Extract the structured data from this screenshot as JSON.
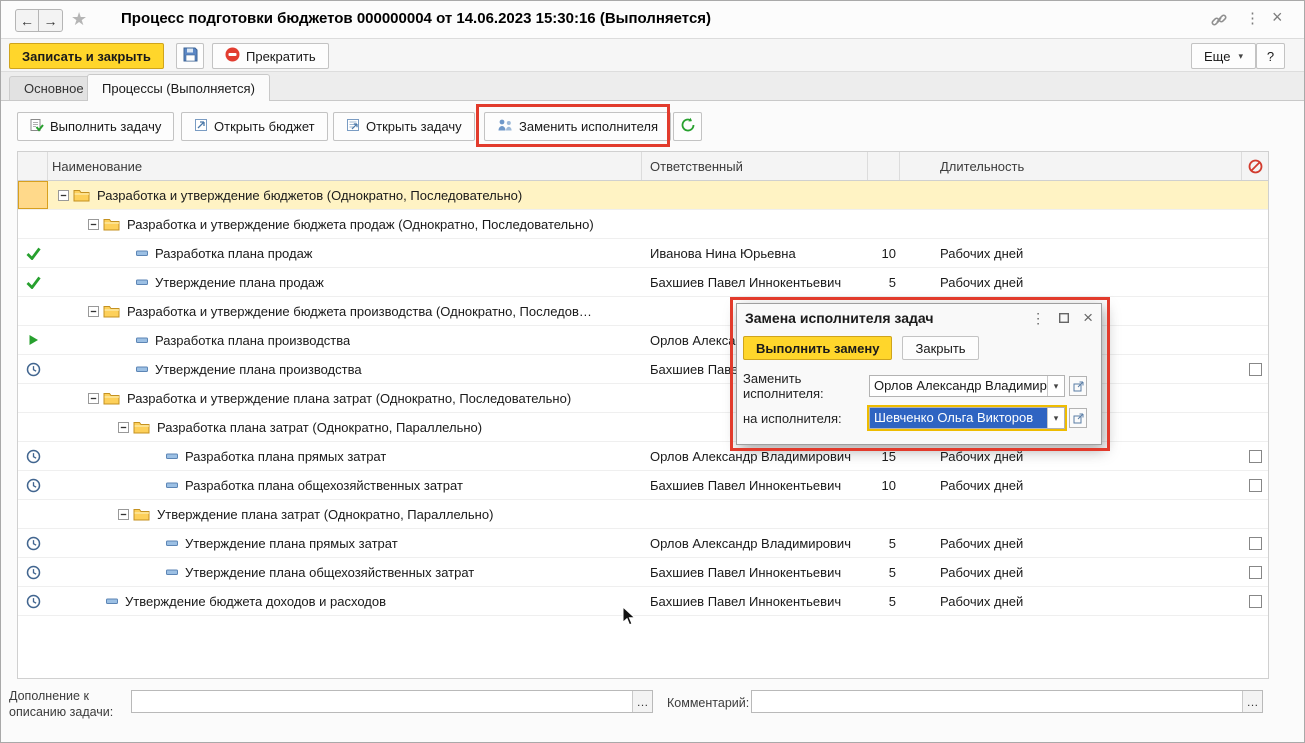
{
  "window": {
    "title": "Процесс подготовки бюджетов 000000004 от 14.06.2023 15:30:16 (Выполняется)"
  },
  "toolbar": {
    "save_and_close": "Записать и закрыть",
    "stop": "Прекратить",
    "more": "Еще",
    "help": "?"
  },
  "tabs": [
    {
      "label": "Основное"
    },
    {
      "label": "Процессы (Выполняется)"
    }
  ],
  "commandbar": {
    "execute_task": "Выполнить задачу",
    "open_budget": "Открыть бюджет",
    "open_task": "Открыть задачу",
    "replace_executor": "Заменить исполнителя"
  },
  "table": {
    "headers": {
      "name": "Наименование",
      "responsible": "Ответственный",
      "duration": "Длительность"
    },
    "rows": [
      {
        "kind": "group",
        "level": 1,
        "status": null,
        "name": "Разработка и утверждение бюджетов (Однократно, Последовательно)",
        "responsible": "",
        "duration": "",
        "units": "",
        "checkbox": false,
        "selected": true
      },
      {
        "kind": "group",
        "level": 2,
        "status": null,
        "name": "Разработка и утверждение бюджета продаж (Однократно, Последовательно)",
        "responsible": "",
        "duration": "",
        "units": "",
        "checkbox": false,
        "selected": false
      },
      {
        "kind": "task",
        "level": 3,
        "status": "done",
        "name": "Разработка плана продаж",
        "responsible": "Иванова Нина Юрьевна",
        "duration": "10",
        "units": "Рабочих дней",
        "checkbox": false,
        "selected": false
      },
      {
        "kind": "task",
        "level": 3,
        "status": "done",
        "name": "Утверждение плана продаж",
        "responsible": "Бахшиев Павел Иннокентьевич",
        "duration": "5",
        "units": "Рабочих дней",
        "checkbox": false,
        "selected": false
      },
      {
        "kind": "group",
        "level": 2,
        "status": null,
        "name": "Разработка и утверждение бюджета производства (Однократно, Последов…",
        "responsible": "",
        "duration": "",
        "units": "",
        "checkbox": false,
        "selected": false
      },
      {
        "kind": "task",
        "level": 3,
        "status": "running",
        "name": "Разработка плана производства",
        "responsible": "Орлов Александр Владимирович",
        "duration": "",
        "units": "",
        "checkbox": false,
        "selected": false
      },
      {
        "kind": "task",
        "level": 3,
        "status": "pending",
        "name": "Утверждение плана производства",
        "responsible": "Бахшиев Павел Иннокентьевич",
        "duration": "",
        "units": "",
        "checkbox": true,
        "selected": false
      },
      {
        "kind": "group",
        "level": 2,
        "status": null,
        "name": "Разработка и утверждение плана затрат (Однократно, Последовательно)",
        "responsible": "",
        "duration": "",
        "units": "",
        "checkbox": false,
        "selected": false
      },
      {
        "kind": "group",
        "level": 3,
        "status": null,
        "name": "Разработка плана затрат (Однократно, Параллельно)",
        "responsible": "",
        "duration": "",
        "units": "",
        "checkbox": false,
        "selected": false
      },
      {
        "kind": "task",
        "level": 4,
        "status": "pending",
        "name": "Разработка плана прямых затрат",
        "responsible": "Орлов Александр Владимирович",
        "duration": "15",
        "units": "Рабочих дней",
        "checkbox": true,
        "selected": false
      },
      {
        "kind": "task",
        "level": 4,
        "status": "pending",
        "name": "Разработка плана общехозяйственных затрат",
        "responsible": "Бахшиев Павел Иннокентьевич",
        "duration": "10",
        "units": "Рабочих дней",
        "checkbox": true,
        "selected": false
      },
      {
        "kind": "group",
        "level": 3,
        "status": null,
        "name": "Утверждение плана затрат (Однократно, Параллельно)",
        "responsible": "",
        "duration": "",
        "units": "",
        "checkbox": false,
        "selected": false
      },
      {
        "kind": "task",
        "level": 4,
        "status": "pending",
        "name": "Утверждение плана прямых затрат",
        "responsible": "Орлов Александр Владимирович",
        "duration": "5",
        "units": "Рабочих дней",
        "checkbox": true,
        "selected": false
      },
      {
        "kind": "task",
        "level": 4,
        "status": "pending",
        "name": "Утверждение плана общехозяйственных затрат",
        "responsible": "Бахшиев Павел Иннокентьевич",
        "duration": "5",
        "units": "Рабочих дней",
        "checkbox": true,
        "selected": false
      },
      {
        "kind": "task",
        "level": 2,
        "status": "pending",
        "name": "Утверждение бюджета доходов и расходов",
        "responsible": "Бахшиев Павел Иннокентьевич",
        "duration": "5",
        "units": "Рабочих дней",
        "checkbox": true,
        "selected": false
      }
    ]
  },
  "dialog": {
    "title": "Замена исполнителя задач",
    "execute_button": "Выполнить замену",
    "close_button": "Закрыть",
    "replace_label": "Заменить исполнителя:",
    "replace_value": "Орлов Александр Владимирович",
    "to_label": "на исполнителя:",
    "to_value": "Шевченко Ольга Викторов"
  },
  "footer": {
    "addition_label": "Дополнение к описанию задачи:",
    "addition_value": "",
    "comment_label": "Комментарий:",
    "comment_value": ""
  },
  "colors": {
    "accent_yellow": "#ffd62b",
    "annotation_red": "#e23b2c",
    "selection_blue": "#2f64c2",
    "status_green": "#27a02e"
  }
}
